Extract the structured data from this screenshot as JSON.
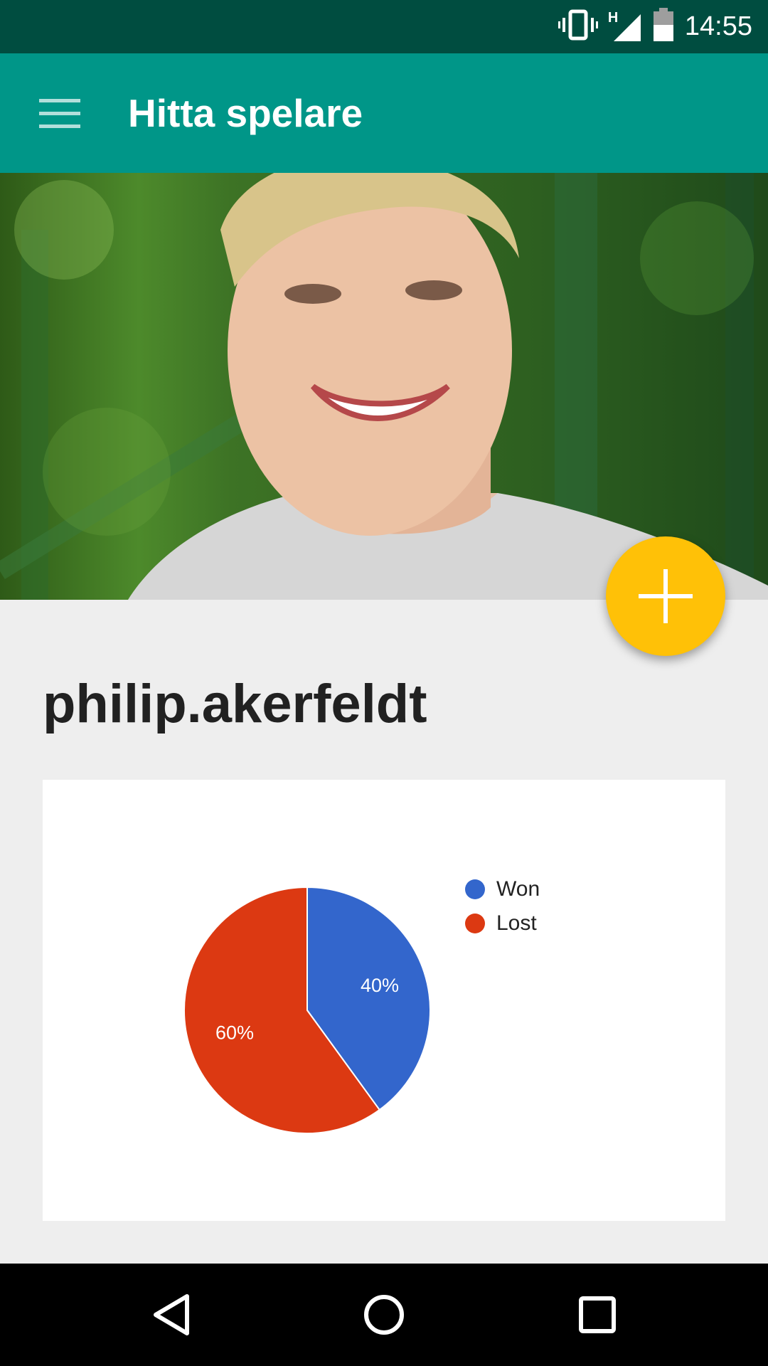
{
  "status_bar": {
    "time": "14:55",
    "network_label": "H",
    "icons": [
      "vibrate-icon",
      "signal-icon",
      "battery-icon"
    ]
  },
  "app_bar": {
    "title": "Hitta spelare",
    "menu_icon": "menu-icon"
  },
  "profile": {
    "username": "philip.akerfeldt",
    "add_button_icon": "plus-icon"
  },
  "chart_data": {
    "type": "pie",
    "slices": [
      {
        "label": "Won",
        "value": 40,
        "display": "40%",
        "color": "#3366cc"
      },
      {
        "label": "Lost",
        "value": 60,
        "display": "60%",
        "color": "#dc3912"
      }
    ],
    "legend_position": "right"
  },
  "nav_bar": {
    "icons": [
      "back-icon",
      "home-icon",
      "recents-icon"
    ]
  },
  "colors": {
    "status_bar": "#004d40",
    "app_bar": "#009688",
    "fab": "#ffc107",
    "background": "#eeeeee"
  }
}
